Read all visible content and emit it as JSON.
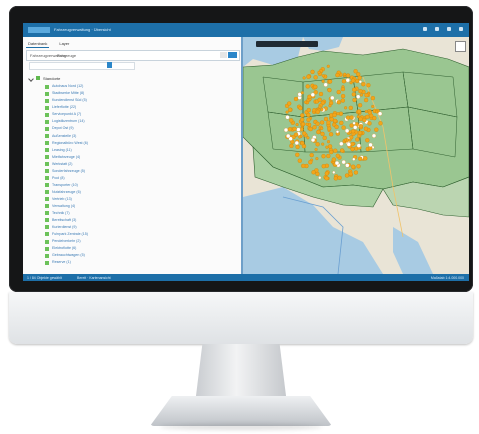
{
  "window": {
    "title": "Fahrzeugverwaltung · Übersicht"
  },
  "tabs": [
    {
      "label": "Datenbank"
    },
    {
      "label": "Layer"
    }
  ],
  "toolbar": {
    "label": "Fahrzeugverwaltung",
    "value": "Fahrzeuge"
  },
  "tree": {
    "root_label": "Standorte",
    "items": [
      {
        "label": "Autohaus Nord (12)"
      },
      {
        "label": "Stadtwerke Mitte (8)"
      },
      {
        "label": "Kundendienst Süd (5)"
      },
      {
        "label": "Lieferflotte (22)"
      },
      {
        "label": "Servicepunkt A (7)"
      },
      {
        "label": "Logistikzentrum (14)"
      },
      {
        "label": "Depot Ost (9)"
      },
      {
        "label": "Außenstelle (3)"
      },
      {
        "label": "Regionalbüro West (6)"
      },
      {
        "label": "Leasing (11)"
      },
      {
        "label": "Mietfahrzeuge (4)"
      },
      {
        "label": "Werkstatt (2)"
      },
      {
        "label": "Sonderfahrzeuge (5)"
      },
      {
        "label": "Pool (8)"
      },
      {
        "label": "Transporter (10)"
      },
      {
        "label": "Nutzfahrzeuge (6)"
      },
      {
        "label": "Vertrieb (13)"
      },
      {
        "label": "Verwaltung (4)"
      },
      {
        "label": "Technik (7)"
      },
      {
        "label": "Bereitschaft (3)"
      },
      {
        "label": "Kurierdienst (9)"
      },
      {
        "label": "Fuhrpark Zentrale (15)"
      },
      {
        "label": "Pendelverkehr (2)"
      },
      {
        "label": "Elektroflotte (6)"
      },
      {
        "label": "Gebrauchtwagen (5)"
      },
      {
        "label": "Reserve (1)"
      }
    ]
  },
  "status": {
    "left": "1 / 84 Objekte gewählt",
    "middle": "Bereit · Kartenansicht",
    "right": "Maßstab 1:4.000.000"
  },
  "colors": {
    "accent": "#1d6fa8",
    "marker": "#f2a51a",
    "region": "#5fa865"
  }
}
